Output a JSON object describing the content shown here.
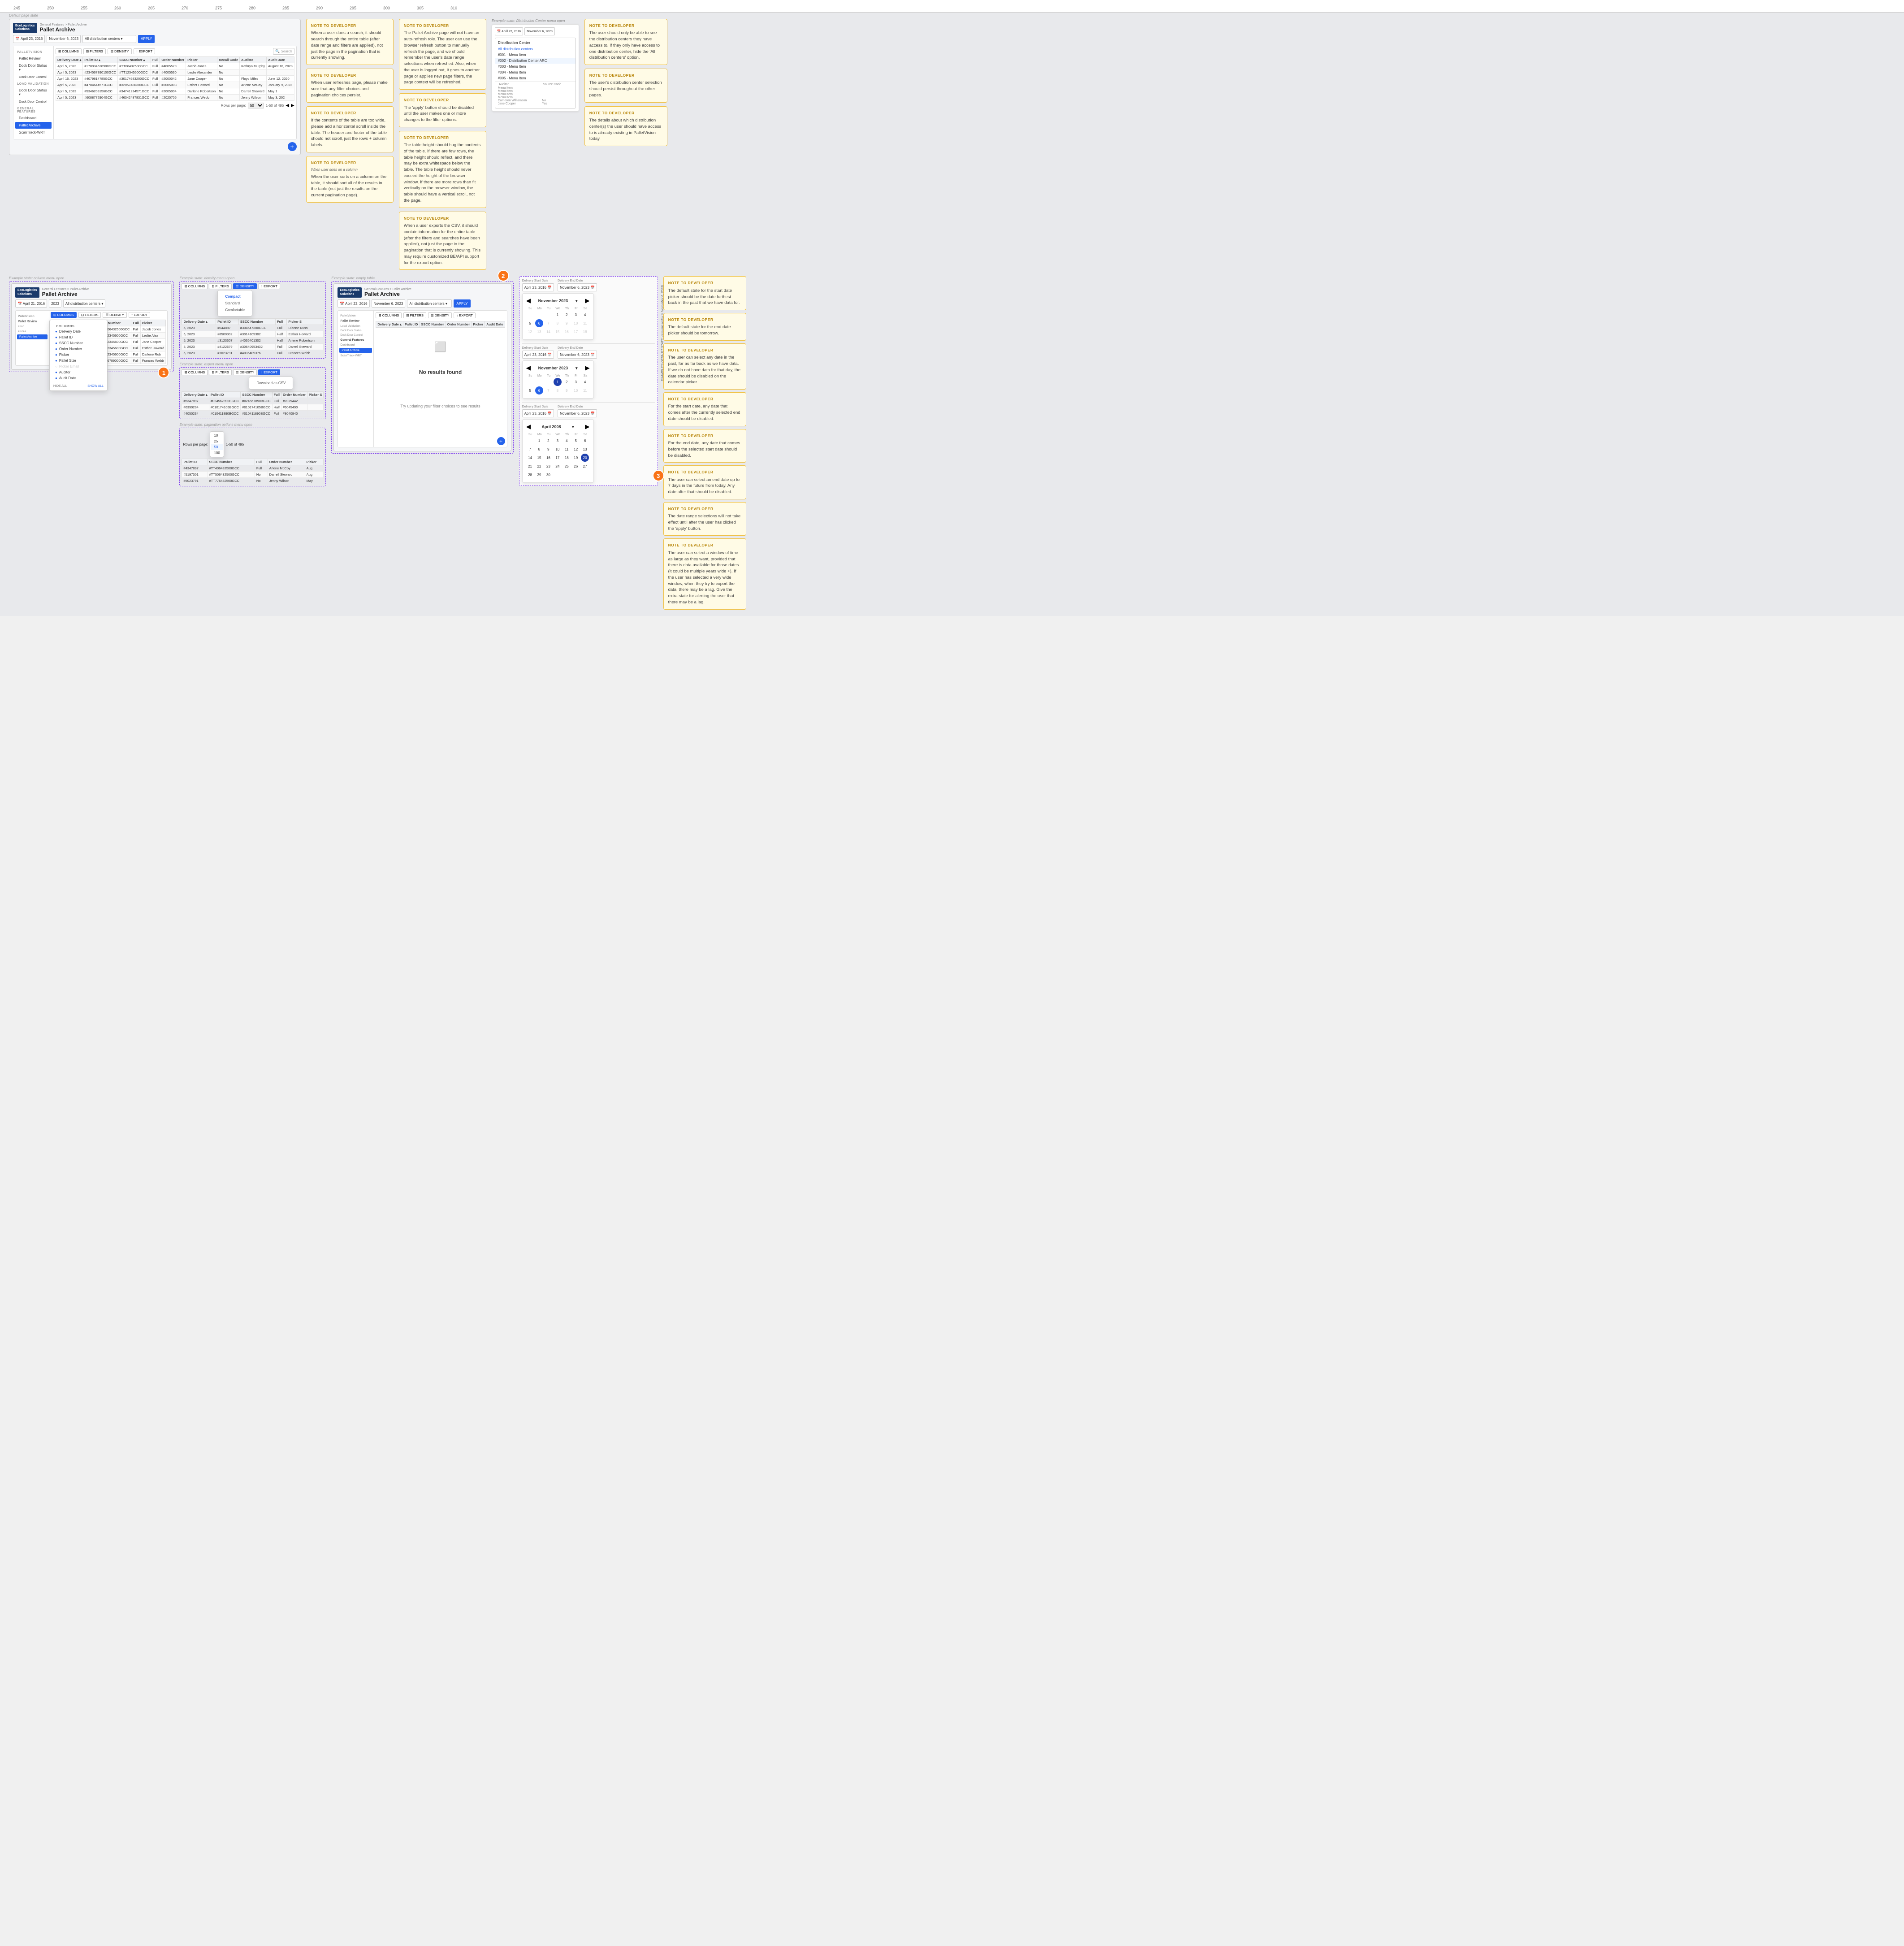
{
  "ruler": {
    "marks": [
      "245",
      "250",
      "255",
      "260",
      "265",
      "270",
      "275",
      "280",
      "285",
      "290",
      "295",
      "300",
      "305",
      "310"
    ]
  },
  "breadcrumb": {
    "root": "General Features",
    "separator": ">",
    "current": "Pallet Archive"
  },
  "page_title": "Pallet Archive",
  "logo": {
    "line1": "EcoLogistics",
    "line2": "Solutions"
  },
  "filter_bar": {
    "start_date": "April 23, 2016",
    "end_date": "November 6, 2023",
    "distribution": "All distribution centers",
    "apply_label": "APPLY"
  },
  "toolbar": {
    "columns_label": "COLUMNS",
    "filters_label": "FILTERS",
    "density_label": "DENSITY",
    "export_label": "EXPORT",
    "search_placeholder": "Search"
  },
  "table": {
    "headers": [
      "Delivery Date",
      "Pallet ID",
      "SSCC Number",
      "Full",
      "Order Number",
      "Picker",
      "Recall Code",
      "Auditor",
      "Audit Date"
    ],
    "rows": [
      [
        "April 5, 2023",
        "#1234567890GCC",
        "#TT06432500GCC",
        "Full",
        "#4005529",
        "Jacob Jones",
        "No",
        "Kathryn Murphy",
        "August 10, 2023"
      ],
      [
        "April 5, 2023",
        "#2345678900GCC",
        "#TT12345600GCC",
        "Full",
        "#4005530",
        "Leslie Alexander",
        "No",
        "",
        ""
      ],
      [
        "April 5, 2023",
        "#3456789010GCC",
        "#TT23456700GCC",
        "Full",
        "#4000002",
        "Jane Cooper",
        "No",
        "Floyd Miles",
        "June 12, 2020"
      ],
      [
        "April 5, 2023",
        "#4567890120GCC",
        "#TT34567800GCC",
        "Full",
        "#2005003",
        "Esther Howard",
        "No",
        "Arlene McCoy",
        "January 9, 2022"
      ],
      [
        "April 5, 2023",
        "#5678901230GCC",
        "#TT45678900GCC",
        "Full",
        "#2005004",
        "Darlene Robertson",
        "No",
        "Darrell Steward",
        "May 1"
      ],
      [
        "April 5, 2023",
        "#6789012340GCC",
        "#TT56789000GCC",
        "Full",
        "#2005005",
        "Frances Webb",
        "No",
        "Jenny Wilson",
        "May 3, 202"
      ]
    ]
  },
  "pagination": {
    "rows_per_page_label": "Rows per page:",
    "rows_per_page": "50",
    "range_label": "1-50 of 495"
  },
  "sidebar": {
    "sections": [
      {
        "title": "PalletVision",
        "items": [
          {
            "label": "Pallet Review",
            "active": false
          },
          {
            "label": "Dock Door Status ▼",
            "active": false
          },
          {
            "label": "Dock Door Control",
            "active": false
          }
        ]
      },
      {
        "title": "Load Validation",
        "items": [
          {
            "label": "Dock Door Status ▼",
            "active": false
          },
          {
            "label": "Dock Door Control",
            "active": false
          }
        ]
      },
      {
        "title": "General Features",
        "items": [
          {
            "label": "Dashboard",
            "active": false
          },
          {
            "label": "Pallet Archive",
            "active": true
          },
          {
            "label": "ScanTrack-WRT",
            "active": false
          }
        ]
      }
    ]
  },
  "notes": {
    "note1": {
      "title": "NOTE TO DEVELOPER",
      "body": "When a user does a search, it should search through the entire table (after date range and filters are applied), not just the page in the pagination that is currently showing."
    },
    "note2": {
      "title": "NOTE TO DEVELOPER",
      "body": "When user refreshes page, please make sure that any filter choices and pagination choices persist."
    },
    "note3": {
      "title": "NOTE TO DEVELOPER",
      "body": "If the contents of the table are too wide, please add a horizontal scroll inside the table. The header and footer of the table should not scroll, just the rows + column labels."
    },
    "note4": {
      "title": "NOTE TO DEVELOPER",
      "body": "When the user sorts on a column on the table, it should sort all of the results in the table (not just the results on the current pagination page)."
    },
    "note5": {
      "title": "NOTE TO DEVELOPER",
      "body": "The Pallet Archive page will not have an auto-refresh role.\n\nThe user can use the browser refresh button to manually refresh the page, and we should remember the user's date range selections when refreshed.\n\nAlso, when the user is logged out, it goes to another page or applies new page filters, the page context will be refreshed."
    },
    "note6": {
      "title": "NOTE TO DEVELOPER",
      "body": "The 'apply' button should be disabled until the user makes one or more changes to the filter options."
    },
    "note7": {
      "title": "NOTE TO DEVELOPER",
      "body": "The table height should hug the contents of the table. If there are few rows, the table height should reflect, and there may be extra whitespace below the table.\n\nThe table height should never exceed the height of the browser window.\n\nIf there are more rows than fit vertically on the browser window, the table should have a vertical scroll, not the page."
    },
    "note8": {
      "title": "NOTE TO DEVELOPER",
      "body": "When a user exports the CSV, it should contain information for the entire table (after the filters and searches have been applied), not just the page in the pagination that is currently showing.\n\nThis may require customized BE/API support for the export option."
    }
  },
  "dist_center_panel": {
    "title": "Distribution Center",
    "items": [
      {
        "id": "#001",
        "name": "Menu Item"
      },
      {
        "id": "#002",
        "name": "Distribution Center ARC"
      },
      {
        "id": "#003",
        "name": "Menu Item"
      },
      {
        "id": "#004",
        "name": "Menu Item"
      },
      {
        "id": "#005",
        "name": "Menu Item"
      },
      {
        "id": "",
        "name": "Cameron Williamson"
      },
      {
        "id": "#0043042",
        "name": "Jane Cooper"
      }
    ],
    "source_code": "Source Code",
    "float_yes": "Yes",
    "picker_name": "Eleanor Williamson",
    "auditor_name": "Floyd Miles"
  },
  "dist_notes": {
    "note1": {
      "title": "NOTE TO DEVELOPER",
      "body": "The user should only be able to see the distribution centers they have access to.\n\nIf they only have access to one distribution center, hide the 'All distribution centers' option."
    },
    "note2": {
      "title": "NOTE TO DEVELOPER",
      "body": "The user's distribution center selection should persist throughout the other pages."
    },
    "note3": {
      "title": "NOTE TO DEVELOPER",
      "body": "The details about which distribution center(s) the user should have access to is already existing in PalletVision today."
    }
  },
  "examples": {
    "col_menu": {
      "label": "Example state: column menu open",
      "section_columns": "COLUMNS",
      "columns": [
        {
          "label": "Delivery Date",
          "checked": true
        },
        {
          "label": "Pallet ID",
          "checked": true
        },
        {
          "label": "SSCC Number",
          "checked": true
        },
        {
          "label": "Order Number",
          "checked": true
        },
        {
          "label": "Picker",
          "checked": true
        },
        {
          "label": "Pallet Size",
          "checked": true
        },
        {
          "label": "Picker Email",
          "checked": false
        },
        {
          "label": "Auditor",
          "checked": true
        },
        {
          "label": "Audit Date",
          "checked": true
        }
      ],
      "hide_all": "HIDE ALL",
      "show_all": "SHOW ALL"
    },
    "density_menu": {
      "label": "Example state: density menu open",
      "options": [
        "Compact",
        "Standard",
        "Comfortable"
      ],
      "selected": "Compact"
    },
    "export_menu": {
      "label": "Example state: export menu open",
      "options": [
        "Download as CSV"
      ]
    },
    "pagination_menu": {
      "label": "Example state: pagination options menu open",
      "options": [
        "10",
        "25",
        "50",
        "100"
      ],
      "current": "50"
    },
    "empty_table": {
      "label": "Example state: empty table",
      "title": "No results found",
      "subtitle": "Try updating your filter choices to see results"
    },
    "date_states": {
      "label": "Example state: date action details",
      "example1_label": "EXAMPLE'S DEFAULT STATE: (assume today is November 6, 2023)",
      "start_date_label": "Delivery Start Date",
      "end_date_label": "Delivery End Date",
      "start_value": "April 23, 2016",
      "end_value": "November 6, 2023",
      "month_year": "November 2023"
    },
    "date_states2": {
      "label": "EXAMPLE 2: UPDATES START AND END DATES, WITH MAX WINDOW (AS FAR BACK AS THERE IS DATA)",
      "start_value": "April 23, 2016",
      "end_value": "November 6, 2023",
      "month_year_2": "April 2008"
    },
    "date_notes": {
      "note1": {
        "title": "NOTE TO DEVELOPER",
        "body": "The default state for the start date picker should be the date furthest back in the past that we have data for."
      },
      "note2": {
        "title": "NOTE TO DEVELOPER",
        "body": "The default state for the end date picker should be tomorrow."
      },
      "note3": {
        "title": "NOTE TO DEVELOPER",
        "body": "The user can select any date in the past, for as far back as we have data.\n\nIf we do not have data for that day, the date should be disabled on the calendar picker."
      },
      "note4": {
        "title": "NOTE TO DEVELOPER",
        "body": "For the start date, any date that comes after the currently selected end date should be disabled."
      },
      "note5": {
        "title": "NOTE TO DEVELOPER",
        "body": "For the end date, any date that comes before the selected start date should be disabled."
      },
      "note6": {
        "title": "NOTE TO DEVELOPER",
        "body": "The user can select an end date up to 7 days in the future from today. Any date after that should be disabled."
      },
      "note7": {
        "title": "NOTE TO DEVELOPER",
        "body": "The date range selections will not take effect until after the user has clicked the 'apply' button."
      },
      "note8": {
        "title": "NOTE TO DEVELOPER",
        "body": "The user can select a window of time as large as they want, provided that there is data available for those dates (it could be multiple years wide +).\n\nIf the user has selected a very wide window, when they try to export the data, there may be a lag. Give the extra state for alerting the user that there may be a lag."
      }
    }
  },
  "annotation_numbers": {
    "1": "1",
    "2": "2",
    "3": "3"
  },
  "action_labels": {
    "when_sorts": "When user sorts on a column",
    "ation": "ation"
  },
  "misc": {
    "full_label": "Full",
    "half_label": "Half",
    "yes": "Yes",
    "no": "No",
    "esther_howard": "Esther Howard",
    "wilson": "Wilson",
    "compact": "Compact",
    "dock_door_control": "Dock Door Control",
    "columns_label": "COLUMNS"
  }
}
